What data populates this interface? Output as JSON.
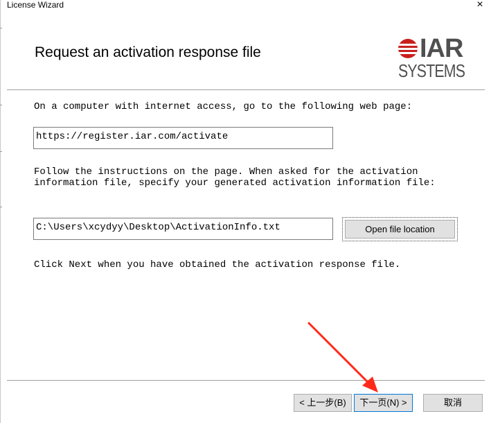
{
  "window": {
    "title": "License Wizard",
    "close_glyph": "×"
  },
  "header": {
    "title": "Request an activation response file",
    "logo": {
      "top_text": "IAR",
      "bottom_text": "SYSTEMS",
      "brand_color": "#c8201c"
    }
  },
  "body": {
    "intro": "On a computer with internet access, go to the following web page:",
    "url_value": "https://register.iar.com/activate",
    "instructions_line1": "Follow the instructions on the page. When asked for the activation",
    "instructions_line2": "information file, specify your generated activation information file:",
    "file_path_value": "C:\\Users\\xcydyy\\Desktop\\ActivationInfo.txt",
    "open_location_label": "Open file location",
    "next_hint": "Click Next when you have obtained the activation response file."
  },
  "footer": {
    "back_label": "< 上一步(B)",
    "next_label": "下一页(N) >",
    "cancel_label": "取消"
  },
  "annotation": {
    "arrow_color": "#ff2a1a",
    "points_to": "next-button"
  }
}
